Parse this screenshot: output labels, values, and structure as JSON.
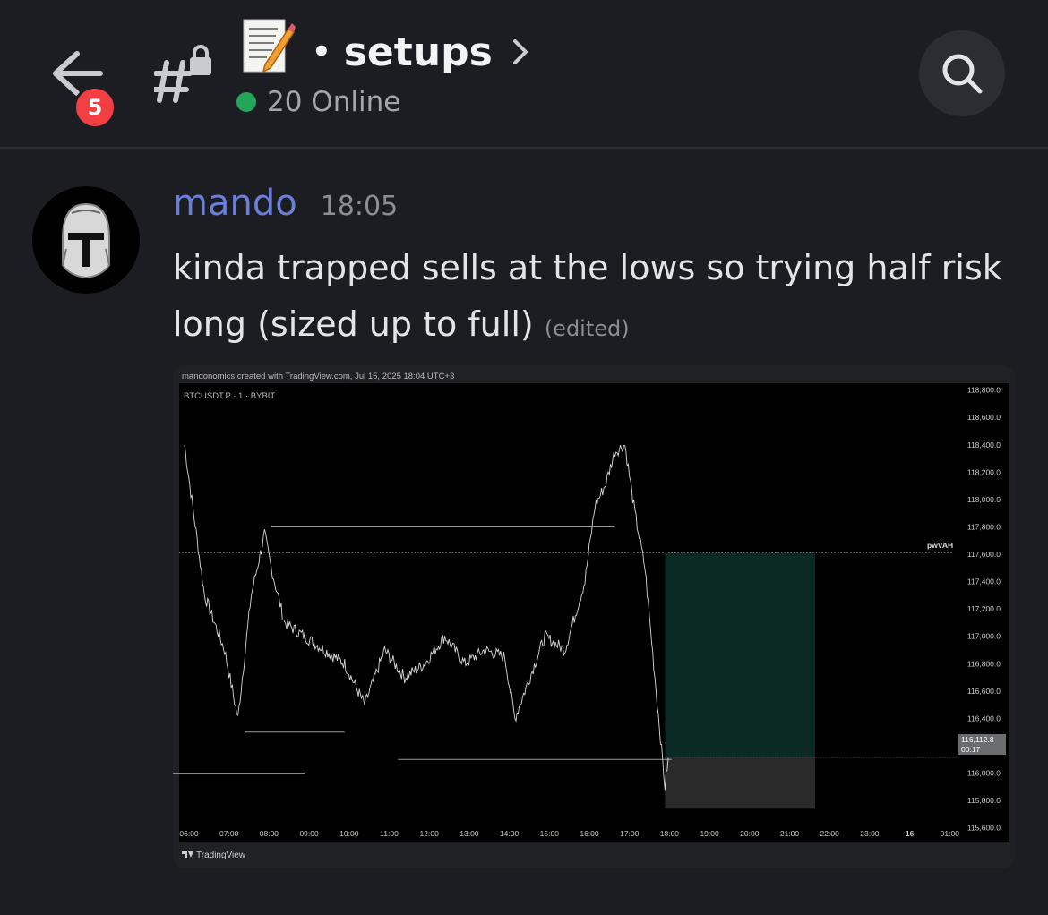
{
  "header": {
    "unread_count": "5",
    "channel_name": "setups",
    "title_dot": "•",
    "online_text": "20 Online",
    "icons": [
      "back-arrow-icon",
      "locked-hashtag-icon",
      "memo-icon",
      "chevron-right-icon",
      "search-icon"
    ]
  },
  "message": {
    "author": "mando",
    "time": "18:05",
    "text": "kinda trapped sells at the lows so trying half risk long (sized up to full)",
    "edited": "(edited)",
    "author_color": "#6b7fd7"
  },
  "chart": {
    "watermark": "mandonomics created with TradingView.com, Jul 15, 2025 18:04 UTC+3",
    "symbol": "BTCUSDT.P · 1 · BYBIT",
    "level_label": "pwVAH",
    "price_label": "116,112.8",
    "countdown": "00:17",
    "footer": "TradingView",
    "y_ticks": [
      "118,800.0",
      "118,600.0",
      "118,400.0",
      "118,200.0",
      "118,000.0",
      "117,800.0",
      "117,600.0",
      "117,400.0",
      "117,200.0",
      "117,000.0",
      "116,800.0",
      "116,600.0",
      "116,400.0",
      "116,200.0",
      "116,000.0",
      "115,800.0",
      "115,600.0"
    ],
    "x_ticks": [
      "06:00",
      "07:00",
      "08:00",
      "09:00",
      "10:00",
      "11:00",
      "12:00",
      "13:00",
      "14:00",
      "15:00",
      "16:00",
      "17:00",
      "18:00",
      "19:00",
      "20:00",
      "21:00",
      "22:00",
      "23:00",
      "16",
      "01:00"
    ]
  },
  "chart_data": {
    "type": "line",
    "series": [
      {
        "x": [
          "06:00",
          "06:30",
          "07:00",
          "07:20",
          "07:40",
          "08:00",
          "08:10",
          "08:30",
          "09:00",
          "09:30",
          "10:00",
          "10:30",
          "11:00",
          "11:30",
          "12:00",
          "12:30",
          "13:00",
          "13:30",
          "14:00",
          "14:15",
          "14:30",
          "15:00",
          "15:30",
          "16:00",
          "16:15",
          "16:30",
          "16:45",
          "17:00",
          "17:15",
          "17:30",
          "17:45",
          "18:00",
          "18:05"
        ],
        "y": [
          118400,
          117300,
          116900,
          116400,
          117300,
          117750,
          117500,
          117100,
          117000,
          116900,
          116800,
          116500,
          116900,
          116700,
          116800,
          117000,
          116800,
          116900,
          116850,
          116400,
          116600,
          117000,
          116900,
          117400,
          117950,
          118100,
          118350,
          118400,
          117900,
          117500,
          116700,
          115900,
          116112.8
        ]
      }
    ],
    "levels": [
      {
        "name": "pwVAH",
        "y": 117610
      },
      {
        "y": 117800,
        "x": [
          "08:10",
          "16:45"
        ]
      },
      {
        "y": 116300,
        "x": [
          "07:30",
          "10:00"
        ]
      },
      {
        "y": 116100,
        "x": [
          "11:20",
          "18:10"
        ]
      },
      {
        "y": 116000,
        "x": [
          "05:40",
          "09:00"
        ]
      }
    ],
    "position": {
      "type": "long",
      "entry": 116112.8,
      "target": 117610,
      "stop": 115740,
      "x": [
        "18:00",
        "21:45"
      ]
    },
    "ylim": [
      115500,
      118850
    ],
    "profit_color": "#0a2a23",
    "loss_color": "#2a2a2a"
  }
}
